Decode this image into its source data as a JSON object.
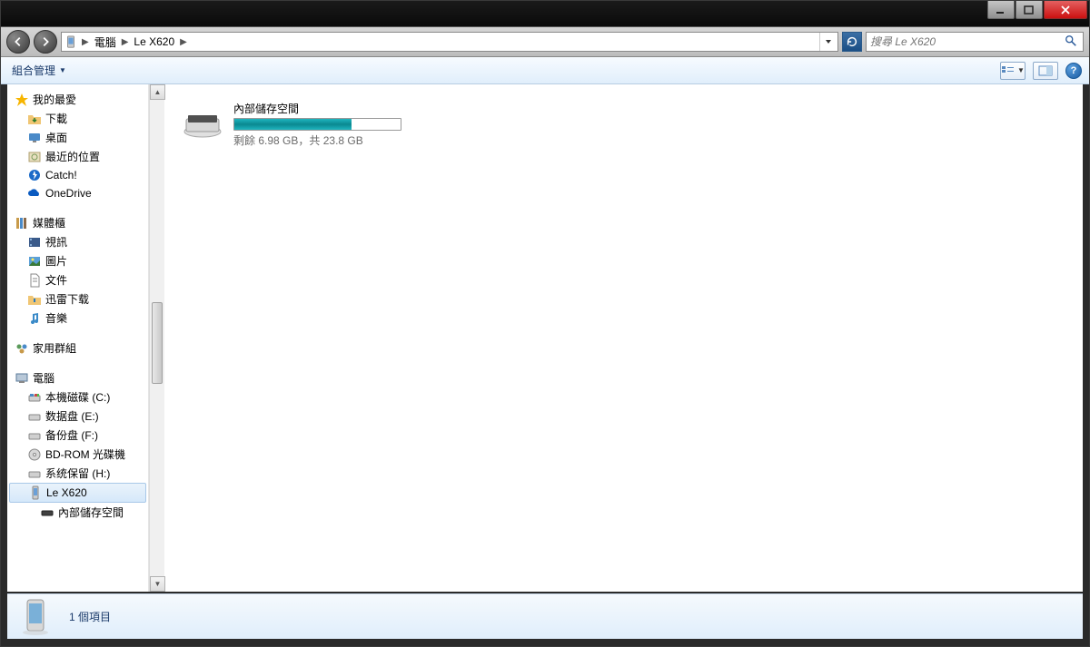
{
  "breadcrumb": {
    "root": "電腦",
    "current": "Le X620"
  },
  "search": {
    "placeholder": "搜尋 Le X620"
  },
  "toolbar": {
    "organize": "組合管理"
  },
  "sidebar": {
    "favorites": {
      "label": "我的最愛",
      "items": [
        "下載",
        "桌面",
        "最近的位置",
        "Catch!",
        "OneDrive"
      ]
    },
    "libraries": {
      "label": "媒體櫃",
      "items": [
        "視訊",
        "圖片",
        "文件",
        "迅雷下载",
        "音樂"
      ]
    },
    "homegroup": {
      "label": "家用群組"
    },
    "computer": {
      "label": "電腦",
      "items": [
        "本機磁碟 (C:)",
        "数据盘 (E:)",
        "备份盘 (F:)",
        "BD-ROM 光碟機",
        "系统保留 (H:)",
        "Le X620"
      ],
      "sub": "內部儲存空間"
    }
  },
  "content": {
    "drive": {
      "name": "內部儲存空間",
      "free_prefix": "剩餘 ",
      "free": "6.98 GB",
      "sep": "，共 ",
      "total": "23.8 GB",
      "fill_percent": 70.6
    }
  },
  "status": {
    "text": "1 個項目"
  }
}
